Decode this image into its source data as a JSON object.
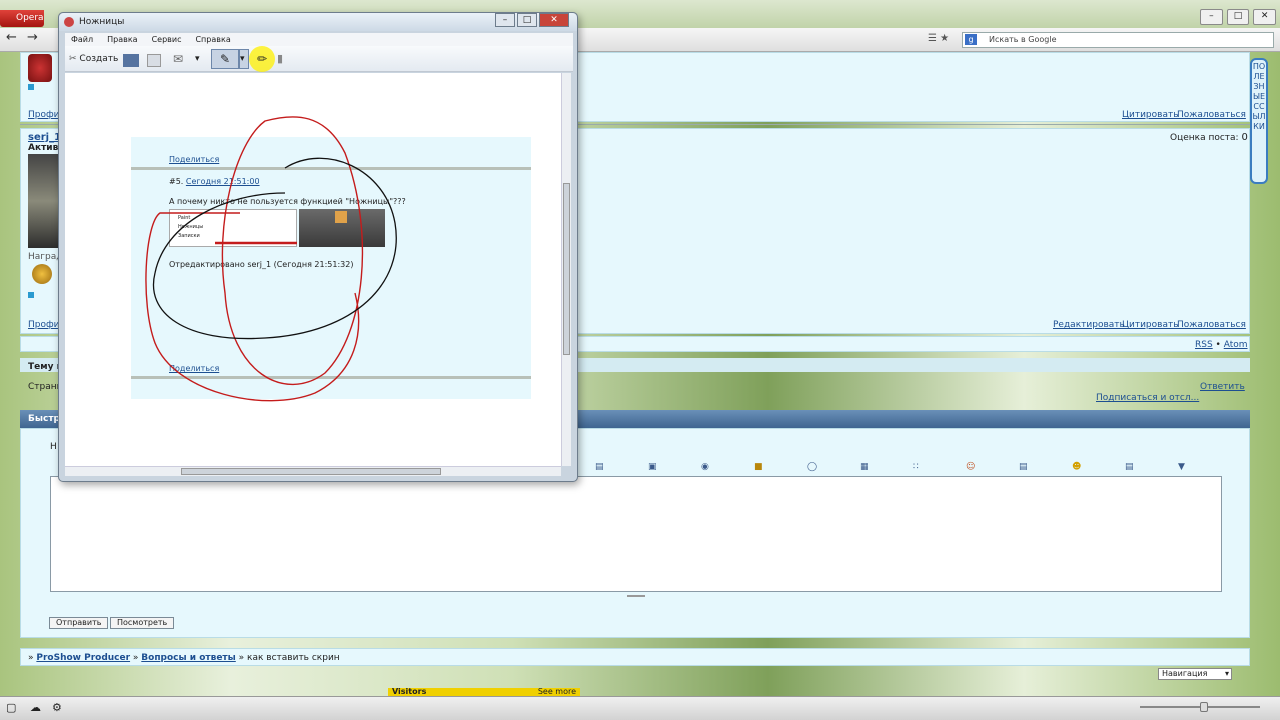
{
  "browser": {
    "menu_label": "Opera",
    "search_placeholder": "Искать в Google",
    "window_controls": [
      "–",
      "□",
      "✕"
    ]
  },
  "page": {
    "posts": [
      {
        "author_fragment": "serj_1",
        "rank_fragment": "Активн",
        "profile_fragment": "Профил",
        "awards_fragment": "Наград",
        "actions_top": [
          "Цитировать",
          "Пожаловаться"
        ],
        "rating_label": "Оценка поста:",
        "rating_value": "0",
        "actions_bottom": [
          "Редактировать",
          "Цитировать",
          "Пожаловаться"
        ]
      }
    ],
    "rss_links": [
      "RSS",
      "Atom"
    ],
    "topic_fragment": "Тему п",
    "pages_fragment": "Страни",
    "reply_link": "Ответить",
    "subscribe_link": "Подписаться и отсл...",
    "quick_reply_fragment": "Быстр",
    "quick_name_fragment": "Н",
    "side_tab_text": "ПОЛЕЗНЫЕ ССЫЛКИ",
    "form_buttons": [
      "Отправить",
      "Посмотреть"
    ],
    "breadcrumbs": [
      "ProShow Producer",
      "Вопросы и ответы",
      "как вставить скрин"
    ],
    "navigation_select": "Навигация",
    "visitors_label": "Visitors",
    "see_more": "See more"
  },
  "snipping_tool": {
    "title": "Ножницы",
    "menu": [
      "Файл",
      "Правка",
      "Сервис",
      "Справка"
    ],
    "toolbar": {
      "new_label": "Создать"
    },
    "capture": {
      "share_top": "Поделиться",
      "post_number": "#5.",
      "post_date": "Сегодня 21:51:00",
      "post_text": "А почему никто не пользуется функцией \"Ножницы\"???",
      "menu_items": [
        "Paint",
        "Ножницы",
        "Записки"
      ],
      "edited_note": "Отредактировано serj_1 (Сегодня 21:51:32)",
      "share_bottom": "Поделиться"
    }
  }
}
